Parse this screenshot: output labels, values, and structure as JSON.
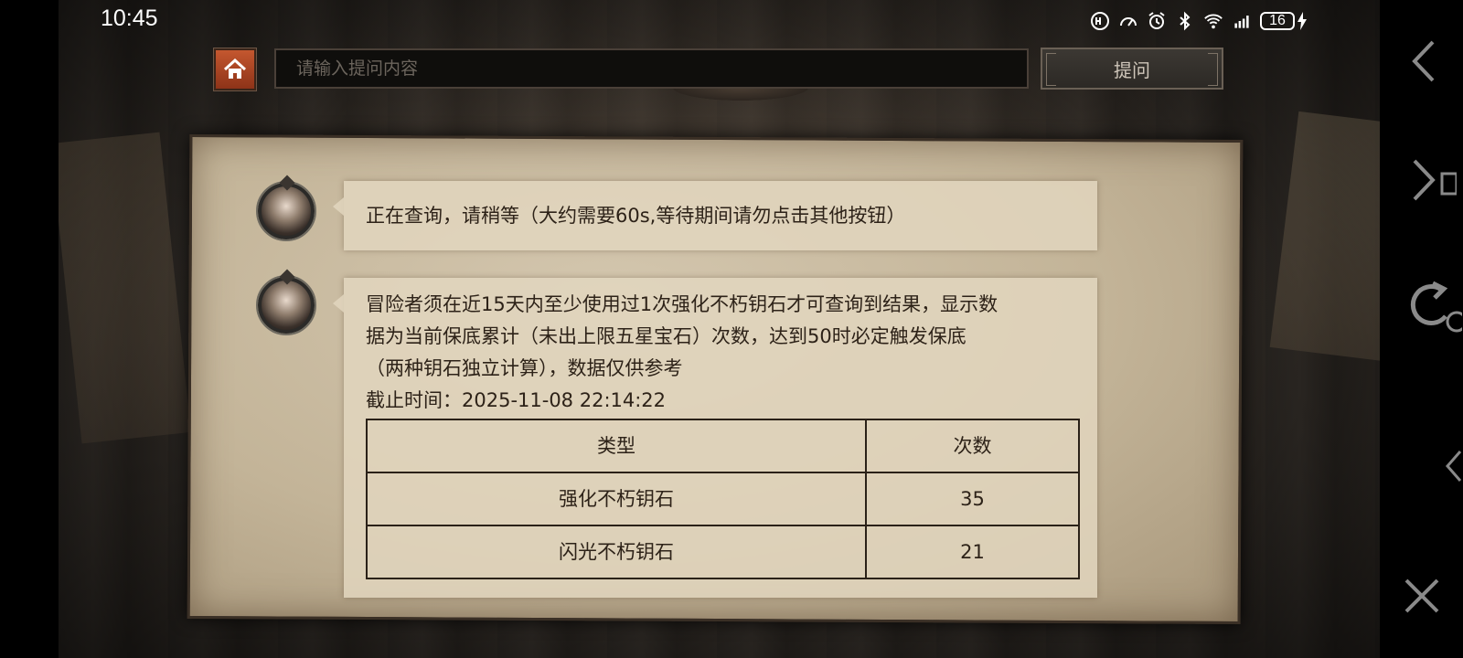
{
  "status_bar": {
    "time": "10:45",
    "icons": [
      "hd-icon",
      "speed-icon",
      "alarm-icon",
      "bluetooth-icon",
      "wifi-icon",
      "cellular-4g-icon"
    ],
    "battery": "16"
  },
  "top_bar": {
    "input_placeholder": "请输入提问内容",
    "ask_label": "提问"
  },
  "messages": {
    "waiting_text": "正在查询，请稍等（大约需要60s,等待期间请勿点击其他按钮）",
    "result_lines": [
      "冒险者须在近15天内至少使用过1次强化不朽钥石才可查询到结果，显示数",
      "据为当前保底累计（未出上限五星宝石）次数，达到50时必定触发保底",
      "（两种钥石独立计算），数据仅供参考",
      "截止时间：2025-11-08 22:14:22"
    ],
    "table": {
      "headers": [
        "类型",
        "次数"
      ],
      "rows": [
        [
          "强化不朽钥石",
          "35"
        ],
        [
          "闪光不朽钥石",
          "21"
        ]
      ]
    }
  },
  "nav_icons": [
    "back-icon",
    "forward-icon",
    "refresh-icon",
    "collapse-icon",
    "close-icon"
  ]
}
